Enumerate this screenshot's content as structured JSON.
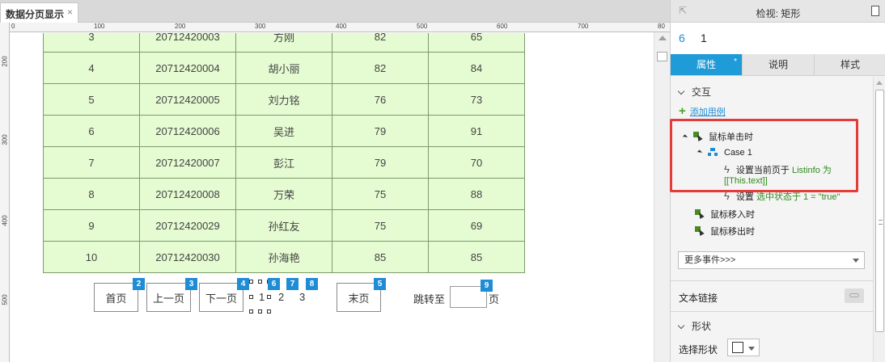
{
  "document": {
    "tab_title": "数据分页显示",
    "close_glyph": "×"
  },
  "rulers": {
    "horizontal": [
      "0",
      "100",
      "200",
      "300",
      "400",
      "500",
      "600",
      "700",
      "80"
    ],
    "vertical": [
      "200",
      "300",
      "400",
      "500"
    ]
  },
  "table": {
    "rows": [
      [
        "3",
        "20712420003",
        "方刚",
        "82",
        "65"
      ],
      [
        "4",
        "20712420004",
        "胡小丽",
        "82",
        "84"
      ],
      [
        "5",
        "20712420005",
        "刘力铭",
        "76",
        "73"
      ],
      [
        "6",
        "20712420006",
        "吴进",
        "79",
        "91"
      ],
      [
        "7",
        "20712420007",
        "彭江",
        "79",
        "70"
      ],
      [
        "8",
        "20712420008",
        "万荣",
        "75",
        "88"
      ],
      [
        "9",
        "20712420029",
        "孙红友",
        "75",
        "69"
      ],
      [
        "10",
        "20712420030",
        "孙海艳",
        "85",
        "85"
      ]
    ]
  },
  "pager": {
    "first": "首页",
    "prev": "上一页",
    "next": "下一页",
    "last": "末页",
    "page_current": "1",
    "page_2": "2",
    "page_total": "3",
    "jump_label": "跳转至",
    "page_suffix": "页",
    "badges": {
      "first": "2",
      "prev": "3",
      "next": "4",
      "current": "6",
      "seven": "7",
      "eight": "8",
      "last": "5",
      "jump": "9"
    }
  },
  "inspector": {
    "title": "检视: 矩形",
    "selection_number": "6",
    "selection_name": "1",
    "tabs": [
      "属性",
      "说明",
      "样式"
    ],
    "active_tab_star": "*",
    "interaction_section": "交互",
    "add_case": "添加用例",
    "events": {
      "click": "鼠标单击时",
      "case": "Case 1",
      "action1_prefix": "设置当前页于",
      "action1_value": "Listinfo 为 [[This.text]]",
      "action2_prefix": "设置",
      "action2_value": "选中状态于 1 = \"true\"",
      "mouse_enter": "鼠标移入时",
      "mouse_leave": "鼠标移出时"
    },
    "more_events": "更多事件>>>",
    "text_link": "文本链接",
    "shape_section": "形状",
    "select_shape": "选择形状"
  },
  "colors": {
    "accent": "#1f9bd8",
    "badge": "#1f8dd6",
    "cell_bg": "#e5fbd2",
    "cell_border": "#7d9a6a",
    "highlight": "#e43b3b",
    "action_text": "#2e8b1e"
  }
}
